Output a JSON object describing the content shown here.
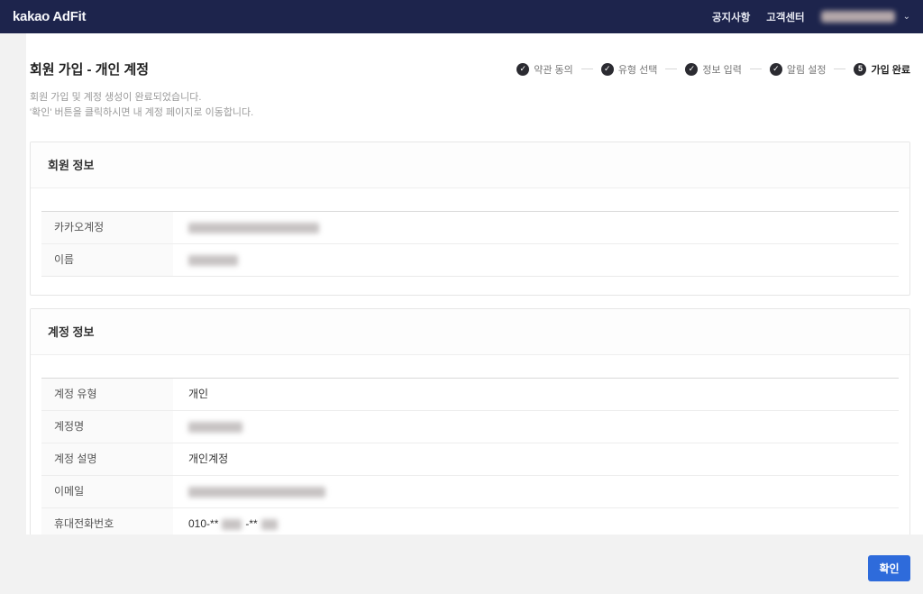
{
  "navbar": {
    "logo": "kakao AdFit",
    "links": [
      {
        "label": "공지사항"
      },
      {
        "label": "고객센터"
      }
    ]
  },
  "icons": {
    "check": "✓",
    "chevron_down": "⌄"
  },
  "page": {
    "title": "회원 가입 - 개인 계정",
    "subtitle_line1": "회원 가입 및 계정 생성이 완료되었습니다.",
    "subtitle_line2": "'확인' 버튼을 클릭하시면 내 계정 페이지로 이동합니다."
  },
  "steps": [
    {
      "label": "약관 동의",
      "state": "done"
    },
    {
      "label": "유형 선택",
      "state": "done"
    },
    {
      "label": "정보 입력",
      "state": "done"
    },
    {
      "label": "알림 설정",
      "state": "done"
    },
    {
      "label": "가입 완료",
      "state": "current",
      "badge": "5"
    }
  ],
  "cards": [
    {
      "title": "회원 정보",
      "rows": [
        {
          "label": "카카오계정",
          "segments": [
            {
              "blur": 145
            }
          ]
        },
        {
          "label": "이름",
          "segments": [
            {
              "blur": 55
            }
          ]
        }
      ]
    },
    {
      "title": "계정 정보",
      "rows": [
        {
          "label": "계정 유형",
          "segments": [
            {
              "text": "개인"
            }
          ]
        },
        {
          "label": "계정명",
          "segments": [
            {
              "blur": 60
            }
          ]
        },
        {
          "label": "계정 설명",
          "segments": [
            {
              "text": "개인계정"
            }
          ]
        },
        {
          "label": "이메일",
          "segments": [
            {
              "blur": 152
            }
          ]
        },
        {
          "label": "휴대전화번호",
          "segments": [
            {
              "text": "010-**"
            },
            {
              "blur": 22
            },
            {
              "text": "-**"
            },
            {
              "blur": 18
            }
          ]
        }
      ]
    }
  ],
  "footer": {
    "confirm_label": "확인"
  },
  "colors": {
    "navbar_bg": "#1d244c",
    "accent_blue": "#2e6bdb",
    "step_circle": "#2b2b31",
    "page_bg": "#f2f2f2"
  }
}
